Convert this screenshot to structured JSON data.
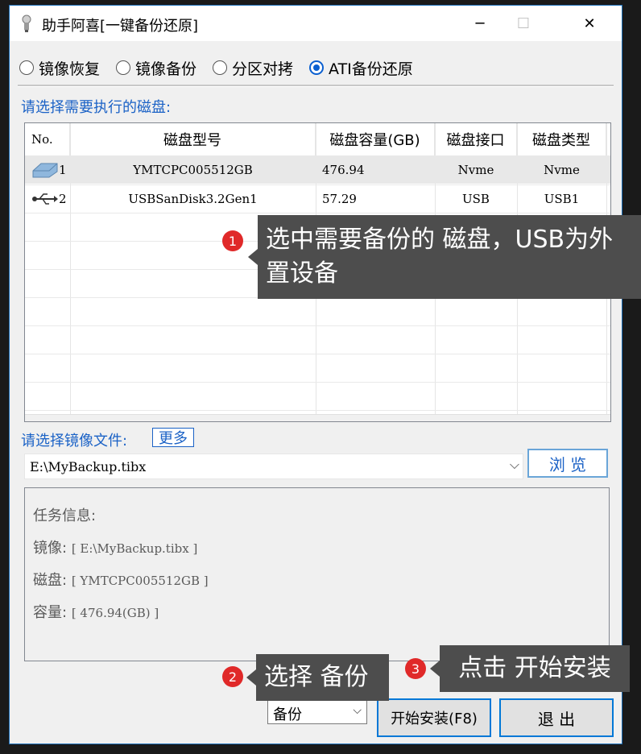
{
  "window": {
    "title": "助手阿喜[一键备份还原]",
    "min_glyph": "─",
    "max_glyph": "☐",
    "close_glyph": "✕"
  },
  "modes": [
    {
      "label": "镜像恢复",
      "selected": false
    },
    {
      "label": "镜像备份",
      "selected": false
    },
    {
      "label": "分区对拷",
      "selected": false
    },
    {
      "label": "ATI备份还原",
      "selected": true
    }
  ],
  "disk_section": {
    "label": "请选择需要执行的磁盘:",
    "columns": [
      "No.",
      "磁盘型号",
      "磁盘容量(GB)",
      "磁盘接口",
      "磁盘类型"
    ],
    "rows": [
      {
        "icon": "hdd-icon",
        "no": "1",
        "model": "YMTCPC005512GB",
        "size": "476.94",
        "interface": "Nvme",
        "type": "Nvme"
      },
      {
        "icon": "usb-icon",
        "no": "2",
        "model": "USBSanDisk3.2Gen1",
        "size": "57.29",
        "interface": "USB",
        "type": "USB1"
      }
    ]
  },
  "image_section": {
    "label": "请选择镜像文件:",
    "more_label": "更多",
    "path": "E:\\MyBackup.tibx",
    "browse_label": "浏 览"
  },
  "task_info": {
    "heading": "任务信息:",
    "image_label": "镜像:",
    "image_value": "[ E:\\MyBackup.tibx ]",
    "disk_label": "磁盘:",
    "disk_value": "[ YMTCPC005512GB ]",
    "capacity_label": "容量:",
    "capacity_value": "[ 476.94(GB) ]"
  },
  "footer": {
    "operation": "备份",
    "start_label": "开始安装(F8)",
    "exit_label": "退 出"
  },
  "annotations": [
    {
      "num": "1",
      "text": "选中需要备份的 磁盘，USB为外置设备"
    },
    {
      "num": "2",
      "text": "选择 备份"
    },
    {
      "num": "3",
      "text": "点击 开始安装"
    }
  ],
  "colors": {
    "accent": "#0078d7",
    "label_blue": "#1b62c6",
    "callout_bg": "#4d4d4d",
    "badge_red": "#e02929"
  }
}
